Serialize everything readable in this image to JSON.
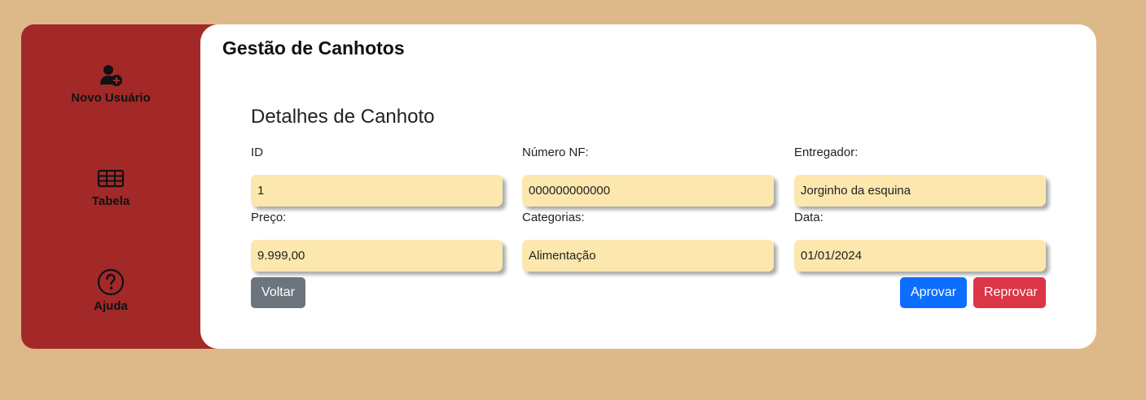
{
  "sidebar": {
    "items": [
      {
        "label": "Novo Usuário",
        "icon": "user-plus-icon"
      },
      {
        "label": "Tabela",
        "icon": "table-icon"
      },
      {
        "label": "Ajuda",
        "icon": "question-circle-icon"
      }
    ]
  },
  "header": {
    "title": "Gestão de Canhotos"
  },
  "form": {
    "title": "Detalhes de Canhoto",
    "fields": [
      {
        "label": "ID",
        "value": "1"
      },
      {
        "label": "Número NF:",
        "value": "000000000000"
      },
      {
        "label": "Entregador:",
        "value": "Jorginho da esquina"
      },
      {
        "label": "Preço:",
        "value": "9.999,00"
      },
      {
        "label": "Categorias:",
        "value": "Alimentação"
      },
      {
        "label": "Data:",
        "value": "01/01/2024"
      }
    ],
    "buttons": {
      "back": "Voltar",
      "approve": "Aprovar",
      "reject": "Reprovar"
    }
  },
  "colors": {
    "background": "#ddb888",
    "sidebar": "#a32929",
    "field_bg": "#fce8ae",
    "back_button": "#6c757d",
    "approve_button": "#0d6efd",
    "reject_button": "#dc3545"
  }
}
